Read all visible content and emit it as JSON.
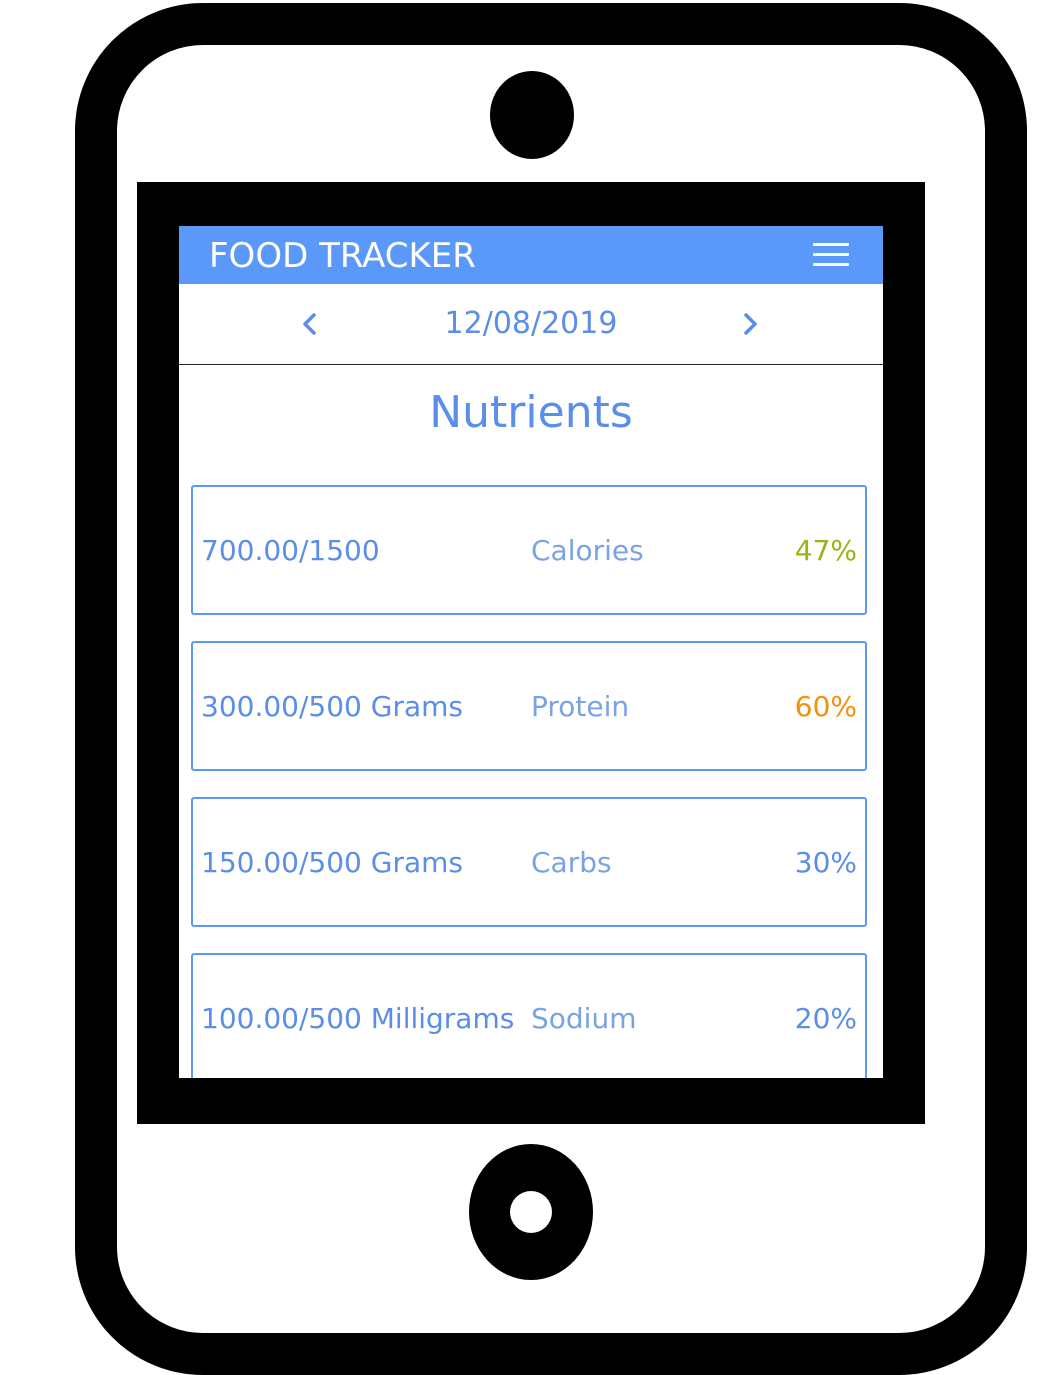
{
  "app": {
    "title": "FOOD TRACKER"
  },
  "icons": {
    "menu": "hamburger-menu-icon",
    "prev": "chevron-left-icon",
    "next": "chevron-right-icon"
  },
  "date_nav": {
    "date": "12/08/2019"
  },
  "section": {
    "title": "Nutrients"
  },
  "colors": {
    "header": "#5a98fa",
    "text_blue": "#5a8ee8",
    "calories_pct": "#9fb11a",
    "protein_pct": "#f5900f",
    "default_pct": "#5a8ee8"
  },
  "nutrients": [
    {
      "amount": "700.00/1500",
      "name": "Calories",
      "percent": "47%"
    },
    {
      "amount": "300.00/500 Grams",
      "name": "Protein",
      "percent": "60%"
    },
    {
      "amount": "150.00/500 Grams",
      "name": "Carbs",
      "percent": "30%"
    },
    {
      "amount": "100.00/500 Milligrams",
      "name": "Sodium",
      "percent": "20%"
    }
  ]
}
